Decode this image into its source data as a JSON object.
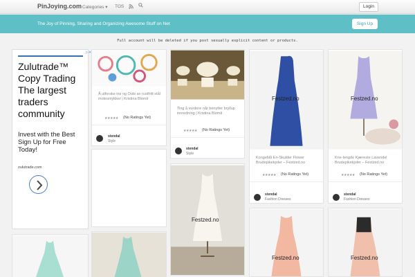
{
  "nav": {
    "brand": "PinJoying.com",
    "categories": "Categories ▾",
    "tos": "TOS",
    "rss_icon": "rss-icon",
    "search_icon": "search-icon",
    "login": "Login"
  },
  "banner": {
    "tagline": "The Joy of Pinning, Sharing and Organizing Awesome Stuff on Net",
    "signup": "Sign Up"
  },
  "notice": "Full account will be deleted if you post sexually explicit content or products.",
  "ad": {
    "headline": "Zulutrade™ Copy Trading The largest traders community",
    "body": "Invest with the Best Sign Up for Free Today!",
    "domain": "zulutrade.com"
  },
  "pins": [
    {
      "title": "Å utforske ins og Outs av rustfritt stål motesmykker | Kristina Blomli",
      "rating": "(No Ratings Yet)",
      "user": "stendal",
      "board": "Style"
    },
    {
      "title": "Ting å vurdere når benytter bryllup innredning | Kristina Blomli",
      "rating": "(No Ratings Yet)",
      "user": "stendal",
      "board": "Style"
    },
    {
      "title": "Kongeblå En-Skulder Flower Brudepikekjoler – Festzed.no",
      "rating": "(No Ratings Yet)",
      "user": "stendal",
      "board": "Fashion Dresses",
      "watermark": "Festzed.no"
    },
    {
      "title": "Kne-lengde Kjæreste Lavendel Brudepikekjoler – Festzed.no",
      "rating": "(No Ratings Yet)",
      "user": "stendal",
      "board": "Fashion Dresses",
      "watermark": "Festzed.no"
    },
    {
      "watermark": "Festzed.no"
    },
    {
      "watermark": "Festzed.no"
    },
    {
      "watermark": "Festzed.no"
    }
  ],
  "colors": {
    "banner": "#5fbfc6",
    "card_bg": "#ffffff",
    "page_bg": "#f2f2f2"
  }
}
